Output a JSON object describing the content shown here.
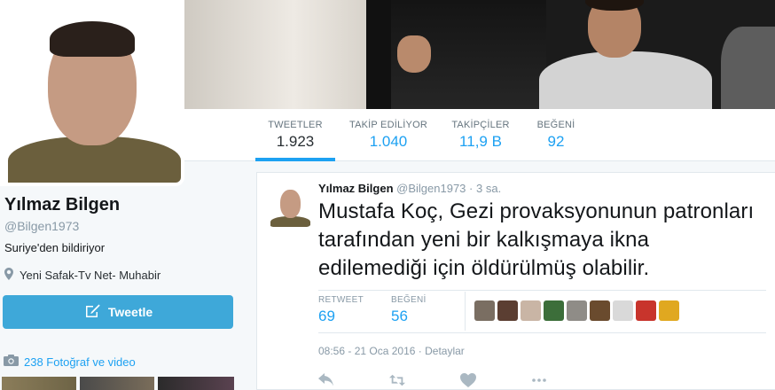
{
  "profile": {
    "name": "Yılmaz Bilgen",
    "handle": "@Bilgen1973",
    "bio": "Suriye'den bildiriyor",
    "location": "Yeni Safak-Tv Net- Muhabir",
    "tweet_button": "Tweetle",
    "photos_link": "238 Fotoğraf ve video"
  },
  "nav": {
    "stats": [
      {
        "label": "TWEETLER",
        "value": "1.923",
        "active": true
      },
      {
        "label": "TAKİP EDİLİYOR",
        "value": "1.040",
        "active": false
      },
      {
        "label": "TAKİPÇİLER",
        "value": "11,9 B",
        "active": false
      },
      {
        "label": "BEĞENİ",
        "value": "92",
        "active": false
      }
    ]
  },
  "tweet": {
    "author": "Yılmaz Bilgen",
    "handle": "@Bilgen1973",
    "separator": "·",
    "time": "3 sa.",
    "text": "Mustafa Koç, Gezi provaksyonunun patronları tarafından yeni bir kalkışmaya ikna edilemediği için öldürülmüş olabilir.",
    "retweet_label": "RETWEET",
    "retweet_count": "69",
    "like_label": "BEĞENİ",
    "like_count": "56",
    "date_line": "08:56 - 21 Oca 2016",
    "date_sep": "·",
    "details": "Detaylar"
  },
  "colors": {
    "accent": "#1da1f2",
    "tweet_button": "#3ea8d9",
    "liker_avatars": [
      "#7a6e62",
      "#5b3e32",
      "#c9b5a5",
      "#3c6e3a",
      "#8f8c87",
      "#6a4b2e",
      "#d9d9d9",
      "#c8342c",
      "#e0a820"
    ]
  }
}
